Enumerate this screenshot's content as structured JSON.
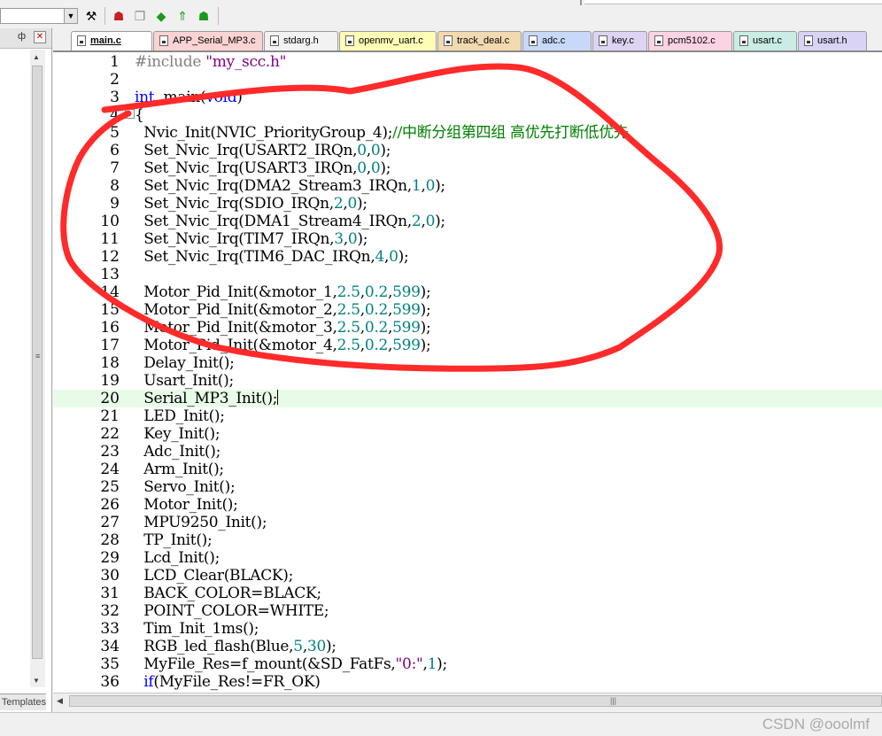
{
  "toolbar": {
    "icons": [
      "wand-icon",
      "layers-red-icon",
      "copy-icon",
      "diamond-green-icon",
      "arrow-green-icon",
      "layers-green-icon"
    ]
  },
  "left_panel": {
    "pin": "ф",
    "close": "✕",
    "bottom_tab": "Templates"
  },
  "tabs": [
    {
      "label": "main.c",
      "color": "#ffffff",
      "active": true
    },
    {
      "label": "APP_Serial_MP3.c",
      "color": "#fbd3d3"
    },
    {
      "label": "stdarg.h",
      "color": "#f2f2f2"
    },
    {
      "label": "openmv_uart.c",
      "color": "#fdfdb6"
    },
    {
      "label": "track_deal.c",
      "color": "#f3d9b0"
    },
    {
      "label": "adc.c",
      "color": "#c7d9f7"
    },
    {
      "label": "key.c",
      "color": "#ddd3f2"
    },
    {
      "label": "pcm5102.c",
      "color": "#fbd3e2"
    },
    {
      "label": "usart.c",
      "color": "#c9ece4"
    },
    {
      "label": "usart.h",
      "color": "#d9d3f5"
    }
  ],
  "code_lines": [
    {
      "n": "1",
      "t": [
        [
          "pp",
          "#include "
        ],
        [
          "str",
          "\"my_scc.h\""
        ]
      ]
    },
    {
      "n": "2",
      "t": []
    },
    {
      "n": "3",
      "t": [
        [
          "kw",
          "int"
        ],
        [
          "",
          "  main("
        ],
        [
          "kw",
          "void"
        ],
        [
          "",
          ")"
        ]
      ]
    },
    {
      "n": "4",
      "t": [
        [
          "",
          "{"
        ]
      ]
    },
    {
      "n": "5",
      "t": [
        [
          "",
          "  Nvic_Init(NVIC_PriorityGroup_4);"
        ],
        [
          "cmt",
          "//中断分组第四组 高优先打断低优先"
        ]
      ]
    },
    {
      "n": "6",
      "t": [
        [
          "",
          "  Set_Nvic_Irq(USART2_IRQn,"
        ],
        [
          "num",
          "0"
        ],
        [
          "",
          ","
        ],
        [
          "num",
          "0"
        ],
        [
          "",
          ");"
        ]
      ]
    },
    {
      "n": "7",
      "t": [
        [
          "",
          "  Set_Nvic_Irq(USART3_IRQn,"
        ],
        [
          "num",
          "0"
        ],
        [
          "",
          ","
        ],
        [
          "num",
          "0"
        ],
        [
          "",
          ");"
        ]
      ]
    },
    {
      "n": "8",
      "t": [
        [
          "",
          "  Set_Nvic_Irq(DMA2_Stream3_IRQn,"
        ],
        [
          "num",
          "1"
        ],
        [
          "",
          ","
        ],
        [
          "num",
          "0"
        ],
        [
          "",
          ");"
        ]
      ]
    },
    {
      "n": "9",
      "t": [
        [
          "",
          "  Set_Nvic_Irq(SDIO_IRQn,"
        ],
        [
          "num",
          "2"
        ],
        [
          "",
          ","
        ],
        [
          "num",
          "0"
        ],
        [
          "",
          ");"
        ]
      ]
    },
    {
      "n": "10",
      "t": [
        [
          "",
          "  Set_Nvic_Irq(DMA1_Stream4_IRQn,"
        ],
        [
          "num",
          "2"
        ],
        [
          "",
          ","
        ],
        [
          "num",
          "0"
        ],
        [
          "",
          ");"
        ]
      ]
    },
    {
      "n": "11",
      "t": [
        [
          "",
          "  Set_Nvic_Irq(TIM7_IRQn,"
        ],
        [
          "num",
          "3"
        ],
        [
          "",
          ","
        ],
        [
          "num",
          "0"
        ],
        [
          "",
          ");"
        ]
      ]
    },
    {
      "n": "12",
      "t": [
        [
          "",
          "  Set_Nvic_Irq(TIM6_DAC_IRQn,"
        ],
        [
          "num",
          "4"
        ],
        [
          "",
          ","
        ],
        [
          "num",
          "0"
        ],
        [
          "",
          ");"
        ]
      ]
    },
    {
      "n": "13",
      "t": []
    },
    {
      "n": "14",
      "t": [
        [
          "",
          "  Motor_Pid_Init(&motor_1,"
        ],
        [
          "num",
          "2.5"
        ],
        [
          "",
          ","
        ],
        [
          "num",
          "0.2"
        ],
        [
          "",
          ","
        ],
        [
          "num",
          "599"
        ],
        [
          "",
          ");"
        ]
      ]
    },
    {
      "n": "15",
      "t": [
        [
          "",
          "  Motor_Pid_Init(&motor_2,"
        ],
        [
          "num",
          "2.5"
        ],
        [
          "",
          ","
        ],
        [
          "num",
          "0.2"
        ],
        [
          "",
          ","
        ],
        [
          "num",
          "599"
        ],
        [
          "",
          ");"
        ]
      ]
    },
    {
      "n": "16",
      "t": [
        [
          "",
          "  Motor_Pid_Init(&motor_3,"
        ],
        [
          "num",
          "2.5"
        ],
        [
          "",
          ","
        ],
        [
          "num",
          "0.2"
        ],
        [
          "",
          ","
        ],
        [
          "num",
          "599"
        ],
        [
          "",
          ");"
        ]
      ]
    },
    {
      "n": "17",
      "t": [
        [
          "",
          "  Motor_Pid_Init(&motor_4,"
        ],
        [
          "num",
          "2.5"
        ],
        [
          "",
          ","
        ],
        [
          "num",
          "0.2"
        ],
        [
          "",
          ","
        ],
        [
          "num",
          "599"
        ],
        [
          "",
          ");"
        ]
      ]
    },
    {
      "n": "18",
      "t": [
        [
          "",
          "  Delay_Init();"
        ]
      ]
    },
    {
      "n": "19",
      "t": [
        [
          "",
          "  Usart_Init();"
        ]
      ]
    },
    {
      "n": "20",
      "t": [
        [
          "",
          "  Serial_MP3_Init();"
        ]
      ],
      "current": true
    },
    {
      "n": "21",
      "t": [
        [
          "",
          "  LED_Init();"
        ]
      ]
    },
    {
      "n": "22",
      "t": [
        [
          "",
          "  Key_Init();"
        ]
      ]
    },
    {
      "n": "23",
      "t": [
        [
          "",
          "  Adc_Init();"
        ]
      ]
    },
    {
      "n": "24",
      "t": [
        [
          "",
          "  Arm_Init();"
        ]
      ]
    },
    {
      "n": "25",
      "t": [
        [
          "",
          "  Servo_Init();"
        ]
      ]
    },
    {
      "n": "26",
      "t": [
        [
          "",
          "  Motor_Init();"
        ]
      ]
    },
    {
      "n": "27",
      "t": [
        [
          "",
          "  MPU9250_Init();"
        ]
      ]
    },
    {
      "n": "28",
      "t": [
        [
          "",
          "  TP_Init();"
        ]
      ]
    },
    {
      "n": "29",
      "t": [
        [
          "",
          "  Lcd_Init();"
        ]
      ]
    },
    {
      "n": "30",
      "t": [
        [
          "",
          "  LCD_Clear(BLACK);"
        ]
      ]
    },
    {
      "n": "31",
      "t": [
        [
          "",
          "  BACK_COLOR=BLACK;"
        ]
      ]
    },
    {
      "n": "32",
      "t": [
        [
          "",
          "  POINT_COLOR=WHITE;"
        ]
      ]
    },
    {
      "n": "33",
      "t": [
        [
          "",
          "  Tim_Init_1ms();"
        ]
      ]
    },
    {
      "n": "34",
      "t": [
        [
          "",
          "  RGB_led_flash(Blue,"
        ],
        [
          "num",
          "5"
        ],
        [
          "",
          ","
        ],
        [
          "num",
          "30"
        ],
        [
          "",
          ");"
        ]
      ]
    },
    {
      "n": "35",
      "t": [
        [
          "",
          "  MyFile_Res=f_mount(&SD_FatFs,"
        ],
        [
          "str",
          "\"0:\""
        ],
        [
          "",
          ","
        ],
        [
          "num",
          "1"
        ],
        [
          "",
          ");"
        ]
      ]
    },
    {
      "n": "36",
      "t": [
        [
          "",
          "  "
        ],
        [
          "kw",
          "if"
        ],
        [
          "",
          "(MyFile_Res!=FR_OK)"
        ]
      ]
    }
  ],
  "watermark": "CSDN @ooolmf",
  "colors": {
    "annotation": "#ff2a2a",
    "current_line": "#e8fbe8"
  }
}
